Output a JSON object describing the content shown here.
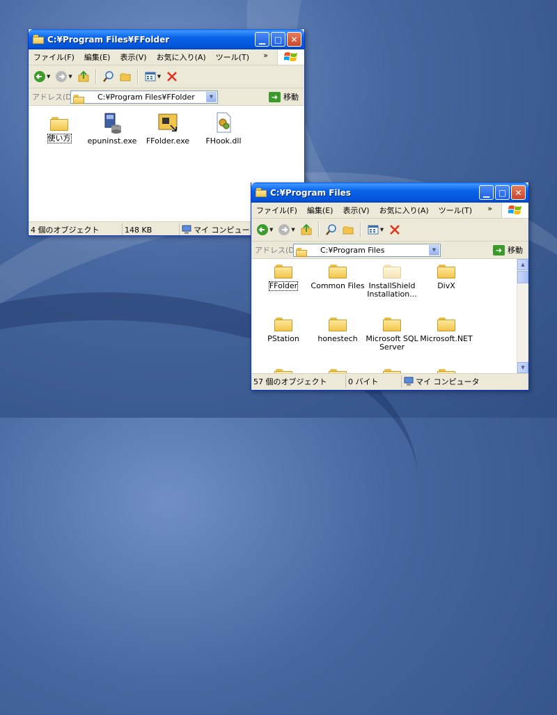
{
  "window1": {
    "title": "C:¥Program Files¥FFolder",
    "menu": [
      "ファイル(F)",
      "編集(E)",
      "表示(V)",
      "お気に入り(A)",
      "ツール(T)"
    ],
    "menu_more": "»",
    "address_label": "アドレス(D)",
    "address_value": "C:¥Program Files¥FFolder",
    "go_label": "移動",
    "files": [
      {
        "name": "使い方",
        "icon": "folder-icon"
      },
      {
        "name": "epuninst.exe",
        "icon": "uninstall-icon"
      },
      {
        "name": "FFolder.exe",
        "icon": "app-icon"
      },
      {
        "name": "FHook.dll",
        "icon": "dll-icon"
      }
    ],
    "status": {
      "count": "4 個のオブジェクト",
      "size": "148 KB",
      "location": "マイ コンピュータ"
    }
  },
  "window2": {
    "title": "C:¥Program Files",
    "menu": [
      "ファイル(F)",
      "編集(E)",
      "表示(V)",
      "お気に入り(A)",
      "ツール(T)"
    ],
    "menu_more": "»",
    "address_label": "アドレス(D)",
    "address_value": "C:¥Program Files",
    "go_label": "移動",
    "folders": [
      {
        "name": "FFolder",
        "selected": true
      },
      {
        "name": "Common Files"
      },
      {
        "name": "InstallShield Installation...",
        "faded": true
      },
      {
        "name": "DivX"
      },
      {
        "name": "PStation"
      },
      {
        "name": "honestech"
      },
      {
        "name": "Microsoft SQL Server"
      },
      {
        "name": "Microsoft.NET"
      }
    ],
    "status": {
      "count": "57 個のオブジェクト",
      "size": "0 バイト",
      "location": "マイ コンピュータ"
    }
  },
  "colors": {
    "titlebar": "#0a64e8",
    "window_bg": "#ece9d8",
    "close_button": "#c8462a"
  }
}
